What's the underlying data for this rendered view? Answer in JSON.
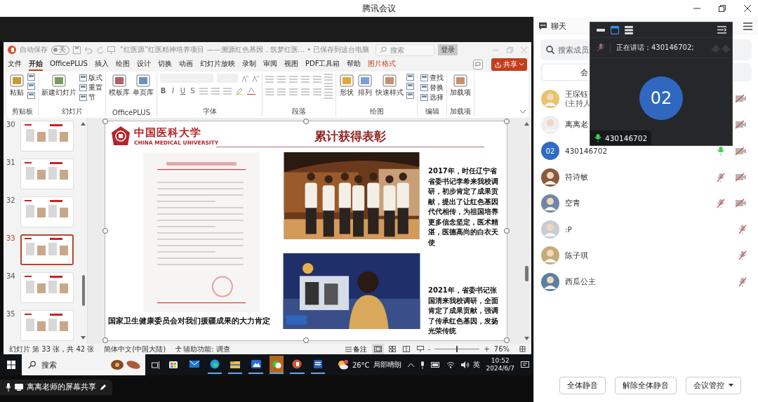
{
  "window": {
    "title": "腾讯会议"
  },
  "shared_screen": {
    "powerpoint": {
      "autosave": {
        "label": "自动保存",
        "toggle": "关",
        "on": false
      },
      "document_title": "“红医源”红医精神培养项目 ——溯源红色基因，筑梦红医... • 已保存到这台电脑",
      "search": {
        "placeholder": "搜索"
      },
      "login_button": "登录",
      "tabs": [
        {
          "label": "文件",
          "selected": false,
          "kind": "standard"
        },
        {
          "label": "开始",
          "selected": true,
          "kind": "standard"
        },
        {
          "label": "OfficePLUS",
          "selected": false,
          "kind": "standard"
        },
        {
          "label": "插入",
          "selected": false,
          "kind": "standard"
        },
        {
          "label": "绘图",
          "selected": false,
          "kind": "standard"
        },
        {
          "label": "设计",
          "selected": false,
          "kind": "standard"
        },
        {
          "label": "切换",
          "selected": false,
          "kind": "standard"
        },
        {
          "label": "动画",
          "selected": false,
          "kind": "standard"
        },
        {
          "label": "幻灯片放映",
          "selected": false,
          "kind": "standard"
        },
        {
          "label": "录制",
          "selected": false,
          "kind": "standard"
        },
        {
          "label": "审阅",
          "selected": false,
          "kind": "standard"
        },
        {
          "label": "视图",
          "selected": false,
          "kind": "standard"
        },
        {
          "label": "PDF工具箱",
          "selected": false,
          "kind": "standard"
        },
        {
          "label": "帮助",
          "selected": false,
          "kind": "standard"
        },
        {
          "label": "图片格式",
          "selected": false,
          "kind": "contextual"
        }
      ],
      "share_button": "共享",
      "ribbon_groups": [
        {
          "label": "剪贴板",
          "items": [
            {
              "kind": "large",
              "label": "粘贴"
            },
            {
              "kind": "icons"
            }
          ]
        },
        {
          "label": "幻灯片",
          "items": [
            {
              "kind": "large",
              "label": "新建幻灯片"
            },
            {
              "kind": "small",
              "label": "版式"
            },
            {
              "kind": "small",
              "label": "重置"
            },
            {
              "kind": "small",
              "label": "节"
            }
          ]
        },
        {
          "label": "OfficePLUS",
          "items": [
            {
              "kind": "large",
              "label": "模板库"
            },
            {
              "kind": "large",
              "label": "单页库"
            }
          ]
        },
        {
          "label": "字体",
          "items": [
            {
              "kind": "font",
              "tools": [
                "B",
                "I",
                "U",
                "S"
              ]
            }
          ]
        },
        {
          "label": "段落",
          "items": [
            {
              "kind": "paragraph"
            }
          ]
        },
        {
          "label": "绘图",
          "items": [
            {
              "kind": "large",
              "label": "形状"
            },
            {
              "kind": "large",
              "label": "排列"
            },
            {
              "kind": "large",
              "label": "快速样式"
            },
            {
              "kind": "icons"
            }
          ]
        },
        {
          "label": "编辑",
          "items": [
            {
              "kind": "small",
              "label": "查找"
            },
            {
              "kind": "small",
              "label": "替换"
            },
            {
              "kind": "small",
              "label": "选择"
            }
          ]
        },
        {
          "label": "加载项",
          "items": [
            {
              "kind": "large",
              "label": "加载项"
            }
          ]
        }
      ],
      "thumbnails": [
        {
          "number": "30",
          "selected": false
        },
        {
          "number": "31",
          "selected": false
        },
        {
          "number": "32",
          "selected": false
        },
        {
          "number": "33",
          "selected": true
        },
        {
          "number": "34",
          "selected": false
        },
        {
          "number": "35",
          "selected": false
        }
      ],
      "slide": {
        "logo_text": "中国医科大学",
        "logo_subtitle": "CHINA MEDICAL UNIVERSITY",
        "title": "累计获得表彰",
        "caption": "国家卫生健康委员会对我们援疆成果的大力肯定",
        "paragraphs": [
          "2017年，时任辽宁省省委书记李希来我校调研，初步肯定了成果贡献，提出了让红色基因代代相传，为祖国培养更多信念坚定，医术精湛，医德高尚的白衣天使",
          "2021年，省委书记张国清来我校调研，全面肯定了成果贡献，强调了传承红色基因，发扬光荣传统"
        ]
      },
      "status_bar": {
        "slide_info": "幻灯片 第 33 张，共 42 张",
        "language": "简体中文(中国大陆)",
        "accessibility": "辅助功能: 调查",
        "notes": "备注",
        "zoom_out": "-",
        "zoom": {
          "level": 0.5
        },
        "zoom_in": "+",
        "zoom_reading": "76%"
      }
    },
    "taskbar": {
      "search": {
        "placeholder": "搜索"
      },
      "apps": [
        {
          "running": false,
          "selected": false
        },
        {
          "running": false,
          "selected": false
        },
        {
          "running": true,
          "selected": false
        },
        {
          "running": true,
          "selected": false
        },
        {
          "running": true,
          "selected": false
        },
        {
          "running": true,
          "selected": true
        },
        {
          "running": true,
          "selected": false
        },
        {
          "running": true,
          "selected": false
        }
      ],
      "weather": {
        "temperature": "26°C",
        "condition": "局部晴朗"
      },
      "input_method": "英",
      "time": "10:52",
      "date": "2024/6/7"
    },
    "sharer_label": "离离老师的屏幕共享"
  },
  "chat_panel": {
    "title": "聊天",
    "search": {
      "placeholder": "搜索成员"
    },
    "tabs": [
      {
        "label": "会",
        "selected": true
      }
    ],
    "members": [
      {
        "name": "王琛钰",
        "role": "(主持人",
        "camera_off": true
      },
      {
        "name": "离离老",
        "camera_off": true
      },
      {
        "name": "430146702",
        "avatar": {
          "kind": "initials",
          "text": "02"
        },
        "mic_muted": false,
        "camera_off": true
      },
      {
        "name": "符诗敏",
        "mic_muted": true,
        "camera_off": true
      },
      {
        "name": "空青",
        "mic_muted": true,
        "camera_off": true
      },
      {
        "name": ":P",
        "mic_muted": true
      },
      {
        "name": "陈子琪",
        "mic_muted": true
      },
      {
        "name": "西瓜公主",
        "mic_muted": true
      }
    ],
    "buttons": [
      {
        "label": "全体静音",
        "dropdown": false
      },
      {
        "label": "解除全体静音",
        "dropdown": false
      },
      {
        "label": "会议管控",
        "dropdown": true
      }
    ]
  },
  "speaker_window": {
    "speaking": "正在讲话：430146702;",
    "avatar": "02",
    "name": "430146702",
    "mic_muted": false
  }
}
